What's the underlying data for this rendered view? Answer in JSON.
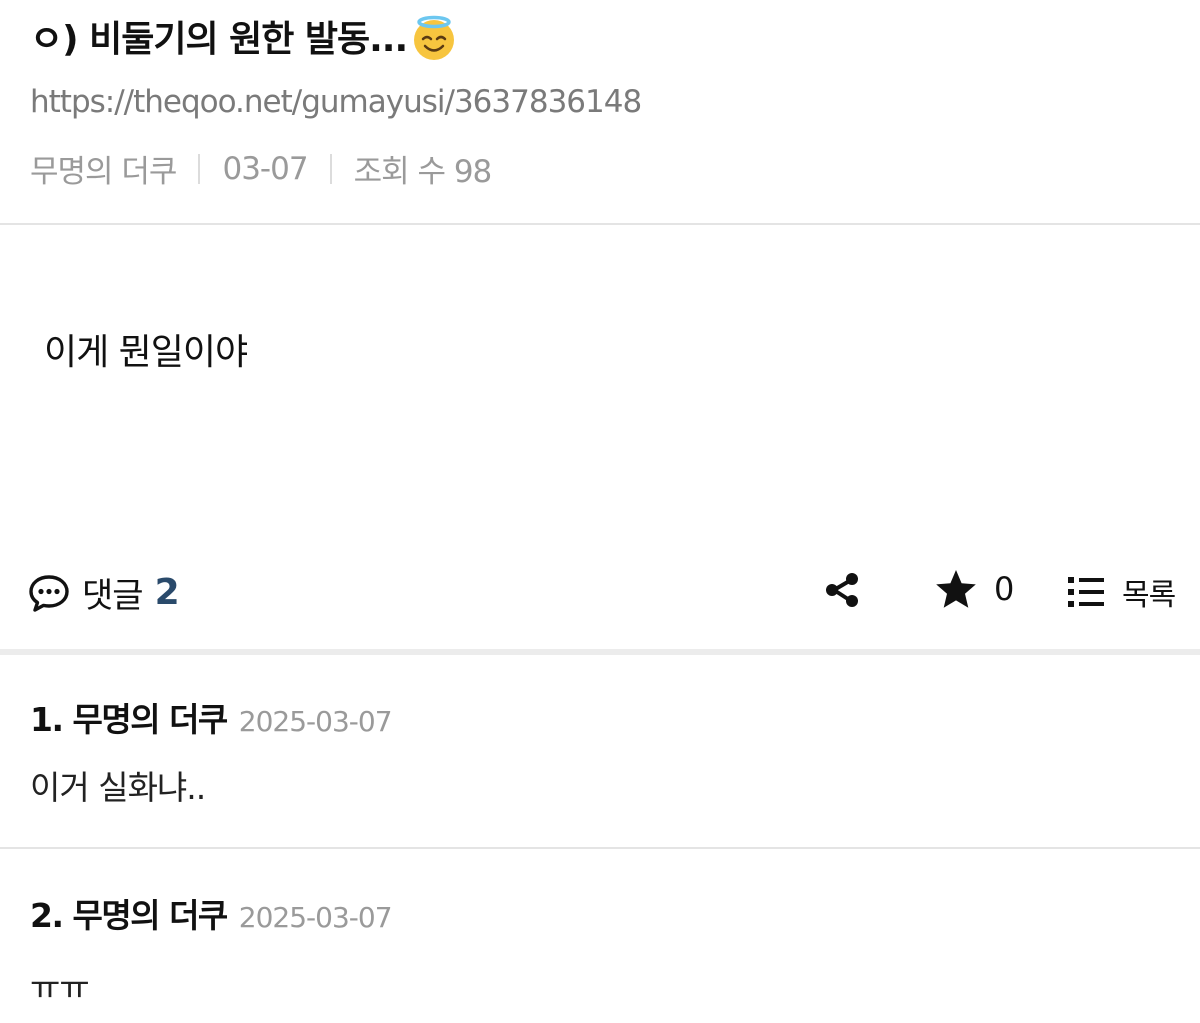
{
  "post": {
    "title": "ㅇ) 비둘기의 원한 발동...",
    "title_emoji": "smiling-face-with-halo",
    "url": "https://theqoo.net/gumayusi/3637836148",
    "author": "무명의 더쿠",
    "date": "03-07",
    "views": "조회 수 98",
    "content": "이게 뭔일이야"
  },
  "actions": {
    "comment_label": "댓글",
    "comment_count": "2",
    "favorite_count": "0",
    "list_label": "목록"
  },
  "comments": [
    {
      "num": "1.",
      "author": "무명의 더쿠",
      "date": "2025-03-07",
      "text": "이거 실화냐.."
    },
    {
      "num": "2.",
      "author": "무명의 더쿠",
      "date": "2025-03-07",
      "text": "ㅠㅠ"
    }
  ],
  "colors": {
    "comment_count": "#2a4a6b",
    "meta_text": "#9a9a9a",
    "divider": "#e4e4e4"
  }
}
